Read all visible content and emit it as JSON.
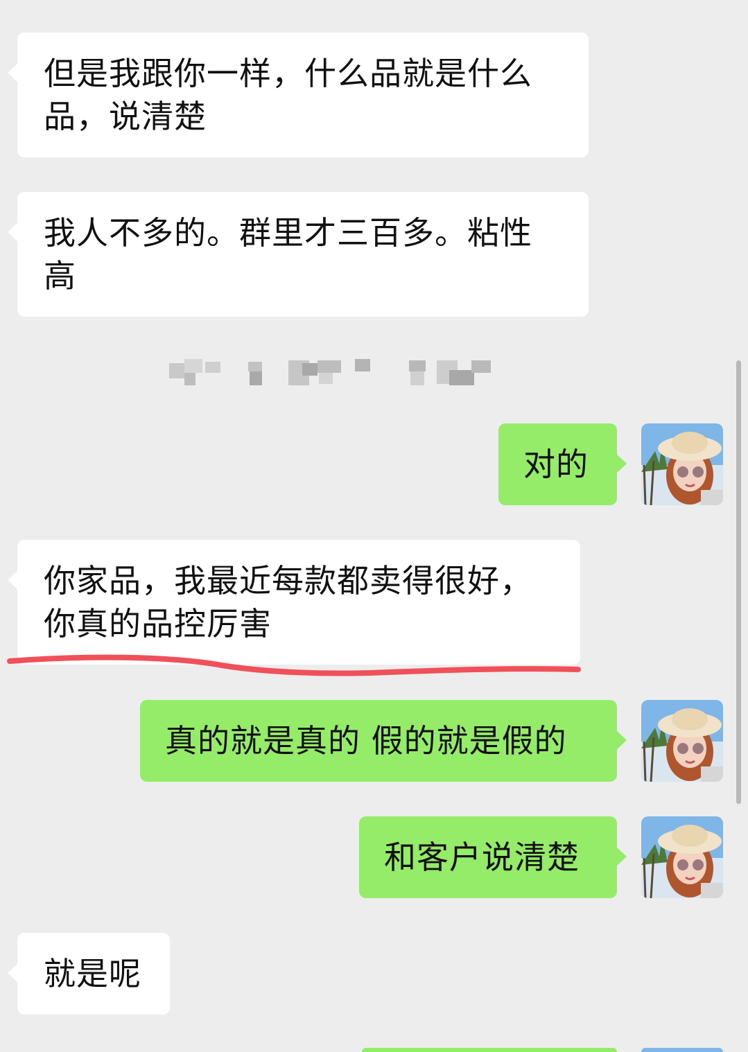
{
  "theme": {
    "background": "#ededed",
    "incoming_bubble": "#ffffff",
    "outgoing_bubble": "#95ec69",
    "annotation_color": "#f0505a"
  },
  "messages": [
    {
      "direction": "incoming",
      "text": "但是我跟你一样，什么品就是什么品，说清楚"
    },
    {
      "direction": "incoming",
      "text": "我人不多的。群里才三百多。粘性高"
    },
    {
      "direction": "system",
      "text": "",
      "note": "pixelated (redacted)"
    },
    {
      "direction": "outgoing",
      "text": "对的",
      "avatar_icon": "avatar-icon"
    },
    {
      "direction": "incoming",
      "text": "你家品，我最近每款都卖得很好，你真的品控厉害",
      "annotation": "red-underline"
    },
    {
      "direction": "outgoing",
      "text": "真的就是真的 假的就是假的",
      "avatar_icon": "avatar-icon"
    },
    {
      "direction": "outgoing",
      "text": "和客户说清楚",
      "avatar_icon": "avatar-icon"
    },
    {
      "direction": "incoming",
      "text": "就是呢"
    }
  ]
}
